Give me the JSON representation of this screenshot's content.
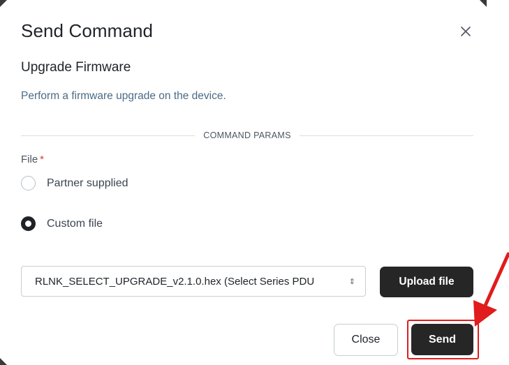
{
  "dialog": {
    "title": "Send Command",
    "close_icon": "close-icon",
    "command_name": "Upgrade Firmware",
    "description": "Perform a firmware upgrade on the device.",
    "section_label": "COMMAND PARAMS"
  },
  "form": {
    "file_label": "File",
    "required_marker": "*",
    "options": [
      {
        "label": "Partner supplied",
        "selected": false
      },
      {
        "label": "Custom file",
        "selected": true
      }
    ],
    "file_value": "RLNK_SELECT_UPGRADE_v2.1.0.hex (Select Series PDU",
    "select_icon": "up-down-chevron-icon",
    "upload_label": "Upload file"
  },
  "footer": {
    "close_label": "Close",
    "send_label": "Send"
  },
  "colors": {
    "primary_dark": "#262626",
    "required": "#d93a3a",
    "description_text": "#4a6b86",
    "annotation_red": "#e01c1c"
  }
}
